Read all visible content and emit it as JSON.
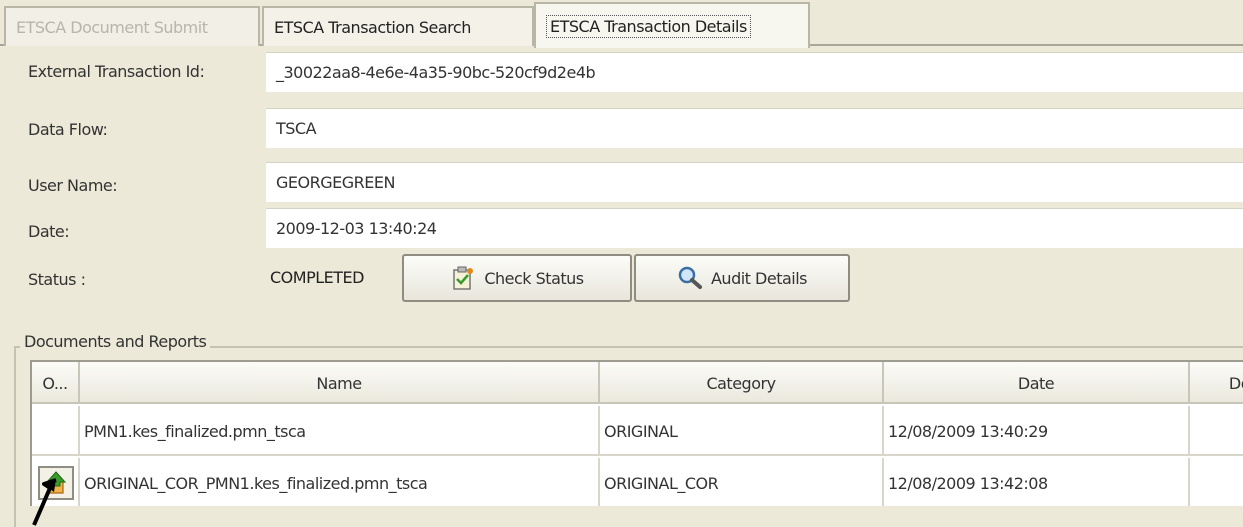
{
  "tabs": [
    {
      "label": "ETSCA Document Submit",
      "state": "disabled"
    },
    {
      "label": "ETSCA Transaction Search",
      "state": "normal"
    },
    {
      "label": "ETSCA Transaction Details",
      "state": "active"
    }
  ],
  "details": {
    "external_id_label": "External Transaction Id:",
    "external_id_value": "_30022aa8-4e6e-4a35-90bc-520cf9d2e4b",
    "dataflow_label": "Data Flow:",
    "dataflow_value": "TSCA",
    "username_label": "User Name:",
    "username_value": "GEORGEGREEN",
    "date_label": "Date:",
    "date_value": "2009-12-03 13:40:24",
    "status_label": "Status :",
    "status_value": "COMPLETED"
  },
  "buttons": {
    "check_status": "Check Status",
    "audit_details": "Audit Details"
  },
  "documents": {
    "group_title": "Documents and Reports",
    "columns": [
      "O...",
      "Name",
      "Category",
      "Date",
      "Do"
    ],
    "rows": [
      {
        "name": "PMN1.kes_finalized.pmn_tsca",
        "category": "ORIGINAL",
        "date": "12/08/2009 13:40:29"
      },
      {
        "name": "ORIGINAL_COR_PMN1.kes_finalized.pmn_tsca",
        "category": "ORIGINAL_COR",
        "date": "12/08/2009 13:42:08"
      }
    ]
  },
  "colors": {
    "background": "#ece9d8",
    "field": "#ffffff",
    "icon_green": "#3a9a2a",
    "icon_orange": "#e08a1e"
  },
  "icons": {
    "check_status": "clipboard-check-icon",
    "audit_details": "magnifier-icon",
    "row_open": "document-up-arrow-icon",
    "pointer": "black-arrow-pointer-icon"
  }
}
